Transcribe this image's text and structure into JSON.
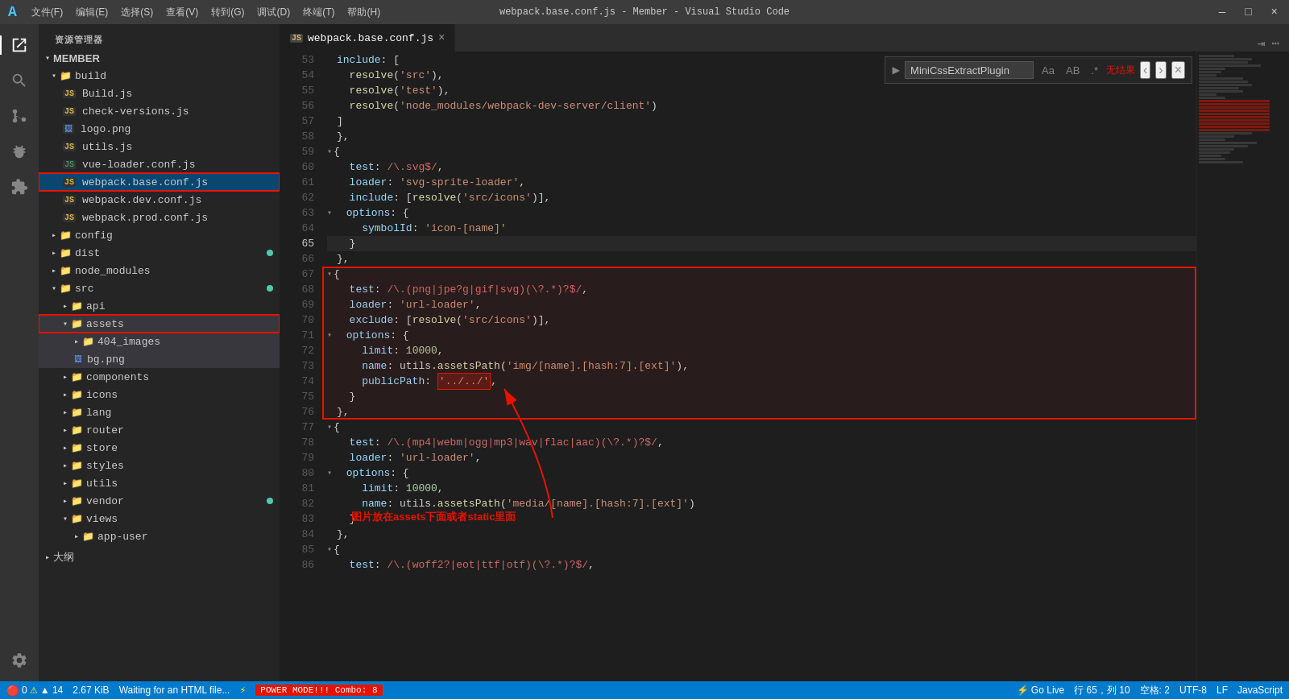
{
  "titlebar": {
    "logo": "A",
    "menu": [
      "文件(F)",
      "编辑(E)",
      "选择(S)",
      "查看(V)",
      "转到(G)",
      "调试(D)",
      "终端(T)",
      "帮助(H)"
    ],
    "title": "webpack.base.conf.js - Member - Visual Studio Code",
    "controls": [
      "—",
      "□",
      "×"
    ]
  },
  "sidebar": {
    "title": "资源管理器",
    "root": "MEMBER",
    "items": [
      {
        "label": "build",
        "type": "folder",
        "level": 1,
        "expanded": true
      },
      {
        "label": "Build.js",
        "type": "js",
        "level": 2
      },
      {
        "label": "check-versions.js",
        "type": "js",
        "level": 2
      },
      {
        "label": "logo.png",
        "type": "img",
        "level": 2
      },
      {
        "label": "utils.js",
        "type": "js",
        "level": 2
      },
      {
        "label": "vue-loader.conf.js",
        "type": "vue",
        "level": 2
      },
      {
        "label": "webpack.base.conf.js",
        "type": "js",
        "level": 2,
        "active": true
      },
      {
        "label": "webpack.dev.conf.js",
        "type": "js",
        "level": 2
      },
      {
        "label": "webpack.prod.conf.js",
        "type": "js",
        "level": 2
      },
      {
        "label": "config",
        "type": "folder",
        "level": 1,
        "expanded": false
      },
      {
        "label": "dist",
        "type": "folder",
        "level": 1,
        "expanded": false,
        "dot": true
      },
      {
        "label": "node_modules",
        "type": "folder",
        "level": 1,
        "expanded": false
      },
      {
        "label": "src",
        "type": "folder",
        "level": 1,
        "expanded": true,
        "dot": true
      },
      {
        "label": "api",
        "type": "folder",
        "level": 2,
        "expanded": false
      },
      {
        "label": "assets",
        "type": "folder",
        "level": 2,
        "expanded": true,
        "selected": true
      },
      {
        "label": "404_images",
        "type": "folder",
        "level": 3,
        "expanded": false
      },
      {
        "label": "bg.png",
        "type": "img",
        "level": 3
      },
      {
        "label": "components",
        "type": "folder",
        "level": 2,
        "expanded": false
      },
      {
        "label": "icons",
        "type": "folder",
        "level": 2,
        "expanded": false
      },
      {
        "label": "lang",
        "type": "folder",
        "level": 2,
        "expanded": false
      },
      {
        "label": "router",
        "type": "folder",
        "level": 2,
        "expanded": false
      },
      {
        "label": "store",
        "type": "folder",
        "level": 2,
        "expanded": false
      },
      {
        "label": "styles",
        "type": "folder",
        "level": 2,
        "expanded": false
      },
      {
        "label": "utils",
        "type": "folder",
        "level": 2,
        "expanded": false
      },
      {
        "label": "vendor",
        "type": "folder",
        "level": 2,
        "expanded": false,
        "dot": true
      },
      {
        "label": "views",
        "type": "folder",
        "level": 2,
        "expanded": true
      },
      {
        "label": "app-user",
        "type": "folder",
        "level": 3,
        "expanded": false
      }
    ]
  },
  "tab": {
    "label": "webpack.base.conf.js",
    "icon": "js"
  },
  "find_widget": {
    "placeholder": "MiniCssExtractPlugin",
    "value": "MiniCssExtractPlugin",
    "result": "无结果",
    "aa_label": "Aa",
    "ab_label": "AB",
    "regex_label": ".*"
  },
  "code_lines": [
    {
      "num": 53,
      "content": "include: [",
      "tokens": [
        {
          "text": "include",
          "class": "prop"
        },
        {
          "text": ": [",
          "class": "plain"
        }
      ]
    },
    {
      "num": 54,
      "content": "  resolve('src'),",
      "tokens": [
        {
          "text": "  ",
          "class": "plain"
        },
        {
          "text": "resolve",
          "class": "fn"
        },
        {
          "text": "(",
          "class": "punc"
        },
        {
          "text": "'src'",
          "class": "str"
        },
        {
          "text": "),",
          "class": "plain"
        }
      ]
    },
    {
      "num": 55,
      "content": "  resolve('test'),",
      "tokens": [
        {
          "text": "  ",
          "class": "plain"
        },
        {
          "text": "resolve",
          "class": "fn"
        },
        {
          "text": "(",
          "class": "punc"
        },
        {
          "text": "'test'",
          "class": "str"
        },
        {
          "text": "),",
          "class": "plain"
        }
      ]
    },
    {
      "num": 56,
      "content": "  resolve('node_modules/webpack-dev-server/client')",
      "tokens": [
        {
          "text": "  ",
          "class": "plain"
        },
        {
          "text": "resolve",
          "class": "fn"
        },
        {
          "text": "(",
          "class": "punc"
        },
        {
          "text": "'node_modules/webpack-dev-server/client'",
          "class": "str"
        },
        {
          "text": ")",
          "class": "plain"
        }
      ]
    },
    {
      "num": 57,
      "content": "]",
      "tokens": [
        {
          "text": "]",
          "class": "plain"
        }
      ]
    },
    {
      "num": 58,
      "content": "},",
      "tokens": [
        {
          "text": "},",
          "class": "plain"
        }
      ]
    },
    {
      "num": 59,
      "content": "{",
      "fold": true,
      "tokens": [
        {
          "text": "{",
          "class": "plain"
        }
      ]
    },
    {
      "num": 60,
      "content": "  test: /\\.svg$/,",
      "tokens": [
        {
          "text": "  test",
          "class": "prop"
        },
        {
          "text": ": ",
          "class": "plain"
        },
        {
          "text": "/\\.svg$/",
          "class": "reg"
        },
        {
          "text": ",",
          "class": "plain"
        }
      ]
    },
    {
      "num": 61,
      "content": "  loader: 'svg-sprite-loader',",
      "tokens": [
        {
          "text": "  loader",
          "class": "prop"
        },
        {
          "text": ": ",
          "class": "plain"
        },
        {
          "text": "'svg-sprite-loader'",
          "class": "str"
        },
        {
          "text": ",",
          "class": "plain"
        }
      ]
    },
    {
      "num": 62,
      "content": "  include: [resolve('src/icons')],",
      "tokens": [
        {
          "text": "  include",
          "class": "prop"
        },
        {
          "text": ": [",
          "class": "plain"
        },
        {
          "text": "resolve",
          "class": "fn"
        },
        {
          "text": "(",
          "class": "punc"
        },
        {
          "text": "'src/icons'",
          "class": "str"
        },
        {
          "text": ")],",
          "class": "plain"
        }
      ]
    },
    {
      "num": 63,
      "content": "  options: {",
      "fold": true,
      "tokens": [
        {
          "text": "  options",
          "class": "prop"
        },
        {
          "text": ": {",
          "class": "plain"
        }
      ]
    },
    {
      "num": 64,
      "content": "    symbolId: 'icon-[name]'",
      "tokens": [
        {
          "text": "    symbolId",
          "class": "prop"
        },
        {
          "text": ": ",
          "class": "plain"
        },
        {
          "text": "'icon-[name]'",
          "class": "str"
        }
      ]
    },
    {
      "num": 65,
      "content": "  }",
      "tokens": [
        {
          "text": "  }",
          "class": "plain"
        }
      ],
      "current": true
    },
    {
      "num": 66,
      "content": "},",
      "tokens": [
        {
          "text": "},",
          "class": "plain"
        }
      ]
    },
    {
      "num": 67,
      "content": "{",
      "fold": true,
      "tokens": [
        {
          "text": "{",
          "class": "plain"
        }
      ],
      "highlight_start": true
    },
    {
      "num": 68,
      "content": "  test: /\\.(png|jpe?g|gif|svg)(\\?.*)?$/,",
      "tokens": [
        {
          "text": "  test",
          "class": "prop"
        },
        {
          "text": ": ",
          "class": "plain"
        },
        {
          "text": "/\\.(png|jpe?g|gif|svg)(\\?.*)?$/",
          "class": "reg"
        },
        {
          "text": ",",
          "class": "plain"
        }
      ]
    },
    {
      "num": 69,
      "content": "  loader: 'url-loader',",
      "tokens": [
        {
          "text": "  loader",
          "class": "prop"
        },
        {
          "text": ": ",
          "class": "plain"
        },
        {
          "text": "'url-loader'",
          "class": "str"
        },
        {
          "text": ",",
          "class": "plain"
        }
      ]
    },
    {
      "num": 70,
      "content": "  exclude: [resolve('src/icons')],",
      "tokens": [
        {
          "text": "  exclude",
          "class": "prop"
        },
        {
          "text": ": [",
          "class": "plain"
        },
        {
          "text": "resolve",
          "class": "fn"
        },
        {
          "text": "(",
          "class": "punc"
        },
        {
          "text": "'src/icons'",
          "class": "str"
        },
        {
          "text": ")],",
          "class": "plain"
        }
      ]
    },
    {
      "num": 71,
      "content": "  options: {",
      "fold": true,
      "tokens": [
        {
          "text": "  options",
          "class": "prop"
        },
        {
          "text": ": {",
          "class": "plain"
        }
      ]
    },
    {
      "num": 72,
      "content": "    limit: 10000,",
      "tokens": [
        {
          "text": "    limit",
          "class": "prop"
        },
        {
          "text": ": ",
          "class": "plain"
        },
        {
          "text": "10000",
          "class": "num"
        },
        {
          "text": ",",
          "class": "plain"
        }
      ]
    },
    {
      "num": 73,
      "content": "    name: utils.assetsPath('img/[name].[hash:7].[ext]'),",
      "tokens": [
        {
          "text": "    name",
          "class": "prop"
        },
        {
          "text": ": ",
          "class": "plain"
        },
        {
          "text": "utils",
          "class": "plain"
        },
        {
          "text": ".",
          "class": "plain"
        },
        {
          "text": "assetsPath",
          "class": "fn"
        },
        {
          "text": "(",
          "class": "punc"
        },
        {
          "text": "'img/[name].[hash:7].[ext]'",
          "class": "str"
        },
        {
          "text": "),",
          "class": "plain"
        }
      ]
    },
    {
      "num": 74,
      "content": "    publicPath: '../../',",
      "tokens": [
        {
          "text": "    publicPath",
          "class": "prop"
        },
        {
          "text": ": ",
          "class": "plain"
        },
        {
          "text": "'../../'",
          "class": "str"
        },
        {
          "text": ",",
          "class": "plain"
        }
      ],
      "inline_highlight": true
    },
    {
      "num": 75,
      "content": "  }",
      "tokens": [
        {
          "text": "  }",
          "class": "plain"
        }
      ]
    },
    {
      "num": 76,
      "content": "},",
      "tokens": [
        {
          "text": "},",
          "class": "plain"
        }
      ],
      "highlight_end": true
    },
    {
      "num": 77,
      "content": "{",
      "fold": true,
      "tokens": [
        {
          "text": "{",
          "class": "plain"
        }
      ]
    },
    {
      "num": 78,
      "content": "  test: /\\.(mp4|webm|ogg|mp3|wav|flac|aac)(\\?.*)?$/,",
      "tokens": [
        {
          "text": "  test",
          "class": "prop"
        },
        {
          "text": ": ",
          "class": "plain"
        },
        {
          "text": "/\\.(mp4|webm|ogg|mp3|wav|flac|aac)(\\?.*)?$/",
          "class": "reg"
        },
        {
          "text": ",",
          "class": "plain"
        }
      ]
    },
    {
      "num": 79,
      "content": "  loader: 'url-loader',",
      "tokens": [
        {
          "text": "  loader",
          "class": "prop"
        },
        {
          "text": ": ",
          "class": "plain"
        },
        {
          "text": "'url-loader'",
          "class": "str"
        },
        {
          "text": ",",
          "class": "plain"
        }
      ]
    },
    {
      "num": 80,
      "content": "  options: {",
      "fold": true,
      "tokens": [
        {
          "text": "  options",
          "class": "prop"
        },
        {
          "text": ": {",
          "class": "plain"
        }
      ]
    },
    {
      "num": 81,
      "content": "    limit: 10000,",
      "tokens": [
        {
          "text": "    limit",
          "class": "prop"
        },
        {
          "text": ": ",
          "class": "plain"
        },
        {
          "text": "10000",
          "class": "num"
        },
        {
          "text": ",",
          "class": "plain"
        }
      ]
    },
    {
      "num": 82,
      "content": "    name: utils.assetsPath('media/[name].[hash:7].[ext]')",
      "tokens": [
        {
          "text": "    name",
          "class": "prop"
        },
        {
          "text": ": ",
          "class": "plain"
        },
        {
          "text": "utils",
          "class": "plain"
        },
        {
          "text": ".",
          "class": "plain"
        },
        {
          "text": "assetsPath",
          "class": "fn"
        },
        {
          "text": "(",
          "class": "punc"
        },
        {
          "text": "'media/[name].[hash:7].[ext]'",
          "class": "str"
        },
        {
          "text": ")",
          "class": "plain"
        }
      ]
    },
    {
      "num": 83,
      "content": "  }",
      "tokens": [
        {
          "text": "  }",
          "class": "plain"
        }
      ]
    },
    {
      "num": 84,
      "content": "},",
      "tokens": [
        {
          "text": "},",
          "class": "plain"
        }
      ]
    },
    {
      "num": 85,
      "content": "{",
      "fold": true,
      "tokens": [
        {
          "text": "{",
          "class": "plain"
        }
      ]
    },
    {
      "num": 86,
      "content": "  test: /\\.(woff2?|eot|ttf|otf)(\\?.*)?$/,",
      "tokens": [
        {
          "text": "  test",
          "class": "prop"
        },
        {
          "text": ": ",
          "class": "plain"
        },
        {
          "text": "/\\.(woff2?|eot|ttf|otf)(\\?.*)?$/",
          "class": "reg"
        },
        {
          "text": ",",
          "class": "plain"
        }
      ]
    }
  ],
  "annotation": {
    "text": "图片放在assets下面或者static里面",
    "arrow": "↗"
  },
  "status": {
    "errors": "0",
    "warnings": "▲ 14",
    "file_size": "2.67 KiB",
    "waiting": "Waiting for an HTML file...",
    "power_mode": "POWER MODE!!! Combo: 8",
    "go_live": "⚡ Go Live",
    "position": "行 65，列 10",
    "spaces": "空格: 2",
    "encoding": "UTF-8",
    "line_ending": "LF",
    "language": "JavaScript"
  },
  "colors": {
    "accent": "#007acc",
    "error": "#e51400",
    "warning": "#ffff00",
    "highlight_box": "rgba(229,20,0,0.08)",
    "active_tab_border": "#007acc"
  }
}
